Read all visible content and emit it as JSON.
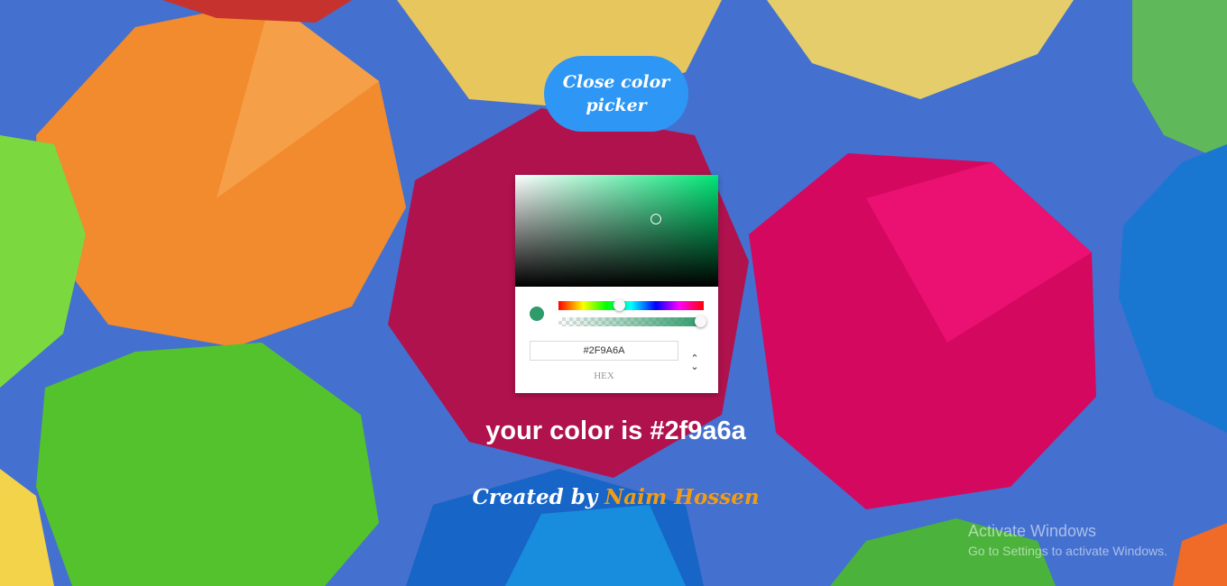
{
  "colors": {
    "background_sky": "#3f6fd1",
    "button_bg": "#2e97f5",
    "selected_color": "#2f9a6a",
    "hue_color": "#00e676",
    "author_accent": "#f39c12"
  },
  "button": {
    "label": "Close color picker"
  },
  "picker": {
    "hex_value": "#2F9A6A",
    "mode_label": "HEX",
    "toggle_icon": "up-down-chevron-icon",
    "hue_level": 0.42,
    "alpha_level": 1.0
  },
  "result": {
    "text": "your color is #2f9a6a"
  },
  "credit": {
    "prefix": "Created by",
    "author": "Naim Hossen"
  },
  "watermark": {
    "title": "Activate Windows",
    "subtitle": "Go to Settings to activate Windows."
  }
}
